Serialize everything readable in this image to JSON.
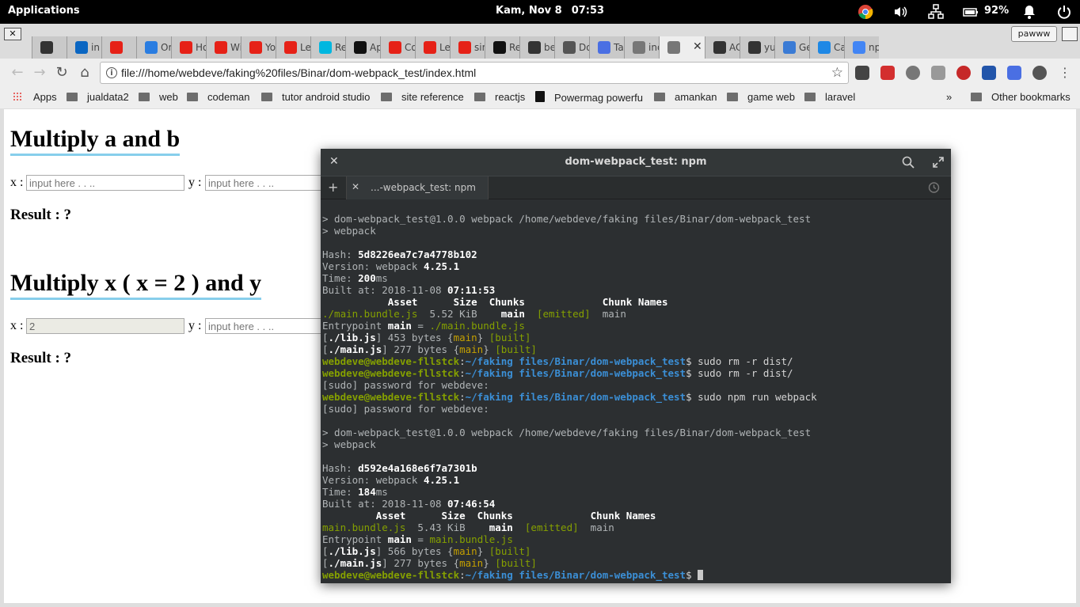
{
  "topbar": {
    "applications_label": "Applications",
    "date": "Kam, Nov 8",
    "time": "07:53",
    "battery_percent": "92%"
  },
  "browser": {
    "profile_name": "pawww",
    "url": "file:///home/webdeve/faking%20files/Binar/dom-webpack_test/index.html",
    "tabs": [
      {
        "icon": "github-icon",
        "title": "",
        "color": "#333333"
      },
      {
        "icon": "linkedin-icon",
        "title": "in",
        "color": "#0a66c2"
      },
      {
        "icon": "youtube-icon",
        "title": "",
        "color": "#e62117"
      },
      {
        "icon": "gem-icon",
        "title": "Or",
        "color": "#2a7de1"
      },
      {
        "icon": "youtube-icon",
        "title": "Ho",
        "color": "#e62117"
      },
      {
        "icon": "youtube-icon",
        "title": "Wi",
        "color": "#e62117"
      },
      {
        "icon": "youtube-icon",
        "title": "Yo",
        "color": "#e62117"
      },
      {
        "icon": "youtube-icon",
        "title": "Le",
        "color": "#e62117"
      },
      {
        "icon": "react-icon",
        "title": "Re",
        "color": "#00b7e0"
      },
      {
        "icon": "medium-icon",
        "title": "Ap",
        "color": "#111111"
      },
      {
        "icon": "youtube-icon",
        "title": "Co",
        "color": "#e62117"
      },
      {
        "icon": "youtube-icon",
        "title": "Le",
        "color": "#e62117"
      },
      {
        "icon": "youtube-icon",
        "title": "sin",
        "color": "#e62117"
      },
      {
        "icon": "medium-icon",
        "title": "Re",
        "color": "#111111"
      },
      {
        "icon": "github-icon",
        "title": "be",
        "color": "#333333"
      },
      {
        "icon": "download-icon",
        "title": "Do",
        "color": "#555555"
      },
      {
        "icon": "docs-icon",
        "title": "Ta",
        "color": "#4a6fe3"
      },
      {
        "icon": "file-icon",
        "title": "ind",
        "color": "#777777"
      },
      {
        "icon": "file-icon",
        "title": "",
        "color": "#777777",
        "active": true
      },
      {
        "icon": "github-icon",
        "title": "AC",
        "color": "#333333"
      },
      {
        "icon": "github-icon",
        "title": "yu",
        "color": "#333333"
      },
      {
        "icon": "generic-icon",
        "title": "Ge",
        "color": "#3a7bd5"
      },
      {
        "icon": "generic-icon",
        "title": "Ca",
        "color": "#1e88e5"
      },
      {
        "icon": "google-icon",
        "title": "np",
        "color": "#4285f4"
      }
    ],
    "bookmarks": [
      {
        "label": "Apps",
        "type": "apps"
      },
      {
        "label": "jualdata2",
        "type": "folder"
      },
      {
        "label": "web",
        "type": "folder"
      },
      {
        "label": "codeman",
        "type": "folder"
      },
      {
        "label": "tutor android studio",
        "type": "folder"
      },
      {
        "label": "site reference",
        "type": "folder"
      },
      {
        "label": "reactjs",
        "type": "folder"
      },
      {
        "label": "Powermag powerfu",
        "type": "site"
      },
      {
        "label": "amankan",
        "type": "folder"
      },
      {
        "label": "game web",
        "type": "folder"
      },
      {
        "label": "laravel",
        "type": "folder"
      }
    ],
    "more_bookmarks": "»",
    "other_bookmarks": "Other bookmarks"
  },
  "page": {
    "section1": {
      "heading": "Multiply a and b",
      "x_label": "x :",
      "y_label": "y :",
      "x_placeholder": "input here . . ..",
      "y_placeholder": "input here . . ..",
      "result": "Result : ?"
    },
    "section2": {
      "heading": "Multiply x ( x = 2 ) and y",
      "x_label": "x :",
      "y_label": "y :",
      "x_value": "2",
      "y_placeholder": "input here . . ..",
      "result": "Result : ?"
    }
  },
  "terminal": {
    "title": "dom-webpack_test: npm",
    "tab_title": "...-webpack_test: npm"
  }
}
